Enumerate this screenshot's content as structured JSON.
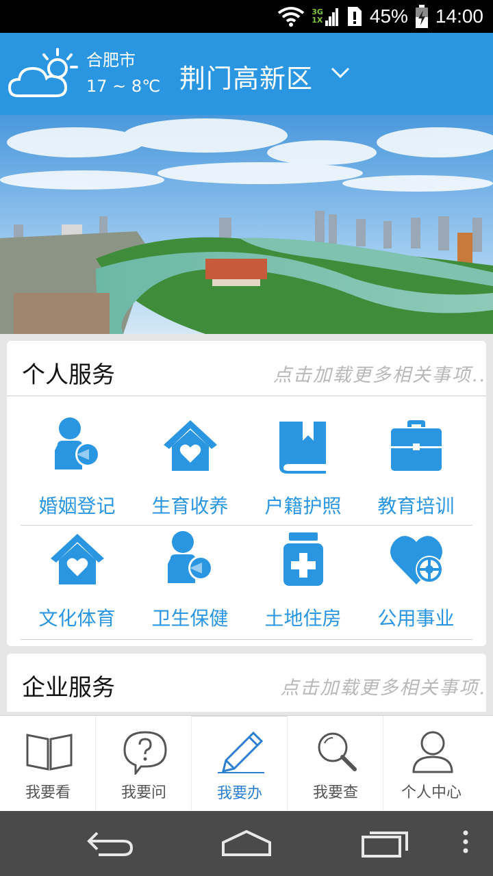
{
  "status_bar": {
    "network_top": "3G",
    "network_bottom": "1X",
    "battery": "45%",
    "time": "14:00",
    "icons": [
      "wifi-icon",
      "signal-icon",
      "sim-alert-icon",
      "battery-charging-icon"
    ]
  },
  "header": {
    "city": "合肥市",
    "temperature": "17 ~ 8℃",
    "district": "荆门高新区",
    "weather_icon": "partly-cloudy-icon",
    "dropdown_icon": "chevron-down-icon"
  },
  "personal_services": {
    "title": "个人服务",
    "more": "点击加载更多相关事项..",
    "items": [
      {
        "label": "婚姻登记",
        "icon": "person-heart-icon"
      },
      {
        "label": "生育收养",
        "icon": "home-heart-icon"
      },
      {
        "label": "户籍护照",
        "icon": "book-icon"
      },
      {
        "label": "教育培训",
        "icon": "briefcase-icon"
      },
      {
        "label": "文化体育",
        "icon": "home-heart-icon"
      },
      {
        "label": "卫生保健",
        "icon": "person-heart-icon"
      },
      {
        "label": "土地住房",
        "icon": "medicine-bottle-icon"
      },
      {
        "label": "公用事业",
        "icon": "heart-target-icon"
      }
    ]
  },
  "enterprise_services": {
    "title": "企业服务",
    "more": "点击加载更多相关事项."
  },
  "bottom_nav": [
    {
      "label": "我要看",
      "icon": "open-book-icon",
      "active": false
    },
    {
      "label": "我要问",
      "icon": "question-bubble-icon",
      "active": false
    },
    {
      "label": "我要办",
      "icon": "pencil-icon",
      "active": true
    },
    {
      "label": "我要查",
      "icon": "magnifier-icon",
      "active": false
    },
    {
      "label": "个人中心",
      "icon": "user-icon",
      "active": false
    }
  ],
  "system_nav": [
    "back-icon",
    "home-icon",
    "recents-icon",
    "menu-icon"
  ],
  "colors": {
    "brand": "#2a96e2",
    "status_bar": "#000000",
    "system_nav": "#4a4a4a",
    "background": "#e6e6e6"
  }
}
